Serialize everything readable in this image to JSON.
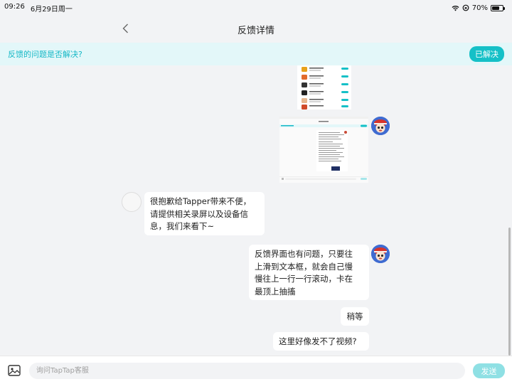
{
  "status_bar": {
    "time": "09:26",
    "date": "6月29日周一",
    "battery": "70%",
    "battery_level": 0.7
  },
  "nav": {
    "title": "反馈详情",
    "back_icon": "chevron-left-icon"
  },
  "banner": {
    "question": "反馈的问题是否解决?",
    "resolved_label": "已解决"
  },
  "messages": [
    {
      "side": "left",
      "text": "很抱歉给Tapper带来不便，\n请提供相关录屏以及设备信\n息，我们来看下~"
    },
    {
      "side": "right",
      "text": "反馈界面也有问题，只要往\n上滑到文本框，就会自己慢\n慢往上一行一行滚动，卡在\n最顶上抽搐"
    },
    {
      "side": "right",
      "text": "稍等"
    },
    {
      "side": "right",
      "text": "这里好像发不了视频?"
    }
  ],
  "input": {
    "placeholder": "询问TapTap客服",
    "send_label": "发送",
    "image_icon": "image-icon"
  },
  "colors": {
    "accent": "#15c0c7",
    "banner_bg": "#e3f7f9",
    "send_disabled": "#8fe0e4"
  }
}
